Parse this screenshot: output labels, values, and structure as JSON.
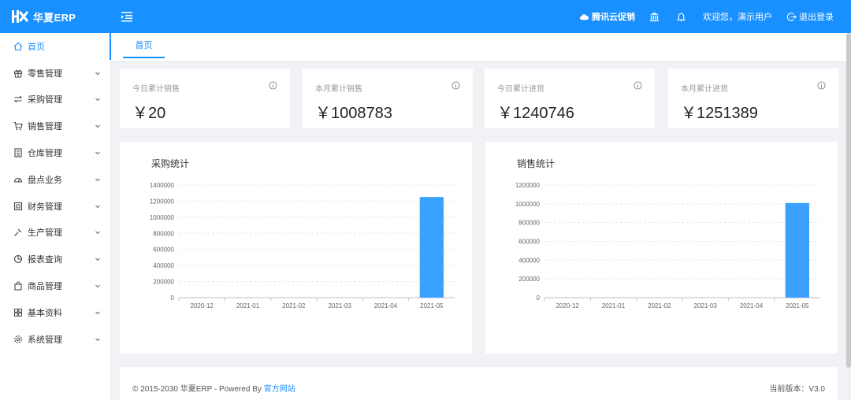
{
  "app": {
    "logo_text": "华夏ERP",
    "brand_color": "#1890ff"
  },
  "header": {
    "promo_label": "腾讯云促销",
    "welcome_text": "欢迎您，演示用户",
    "logout_label": "退出登录"
  },
  "sidebar": {
    "items": [
      {
        "label": "首页",
        "icon": "home-icon"
      },
      {
        "label": "零售管理",
        "icon": "gift-icon"
      },
      {
        "label": "采购管理",
        "icon": "swap-icon"
      },
      {
        "label": "销售管理",
        "icon": "cart-icon"
      },
      {
        "label": "仓库管理",
        "icon": "warehouse-icon"
      },
      {
        "label": "盘点业务",
        "icon": "dashboard-icon"
      },
      {
        "label": "财务管理",
        "icon": "finance-icon"
      },
      {
        "label": "生产管理",
        "icon": "tool-icon"
      },
      {
        "label": "报表查询",
        "icon": "pie-chart-icon"
      },
      {
        "label": "商品管理",
        "icon": "shopping-icon"
      },
      {
        "label": "基本资料",
        "icon": "grid-icon"
      },
      {
        "label": "系统管理",
        "icon": "settings-icon"
      }
    ]
  },
  "tabs": [
    {
      "label": "首页"
    }
  ],
  "stats": [
    {
      "title": "今日累计销售",
      "value": "￥20"
    },
    {
      "title": "本月累计销售",
      "value": "￥1008783"
    },
    {
      "title": "今日累计进货",
      "value": "￥1240746"
    },
    {
      "title": "本月累计进货",
      "value": "￥1251389"
    }
  ],
  "charts": [
    {
      "title": "采购统计"
    },
    {
      "title": "销售统计"
    }
  ],
  "chart_data": [
    {
      "type": "bar",
      "title": "采购统计",
      "categories": [
        "2020-12",
        "2021-01",
        "2021-02",
        "2021-03",
        "2021-04",
        "2021-05"
      ],
      "values": [
        0,
        0,
        0,
        0,
        0,
        1251389
      ],
      "ylim": [
        0,
        1400000
      ],
      "yticks": [
        0,
        200000,
        400000,
        600000,
        800000,
        1000000,
        1200000,
        1400000
      ],
      "grid": true,
      "bar_color": "#3ba1ff"
    },
    {
      "type": "bar",
      "title": "销售统计",
      "categories": [
        "2020-12",
        "2021-01",
        "2021-02",
        "2021-03",
        "2021-04",
        "2021-05"
      ],
      "values": [
        0,
        0,
        0,
        0,
        0,
        1008783
      ],
      "ylim": [
        0,
        1200000
      ],
      "yticks": [
        0,
        200000,
        400000,
        600000,
        800000,
        1000000,
        1200000
      ],
      "grid": true,
      "bar_color": "#3ba1ff"
    }
  ],
  "footer": {
    "copyright": "© 2015-2030 华夏ERP - Powered By ",
    "link_text": "官方网站",
    "version": "当前版本：V3.0"
  }
}
